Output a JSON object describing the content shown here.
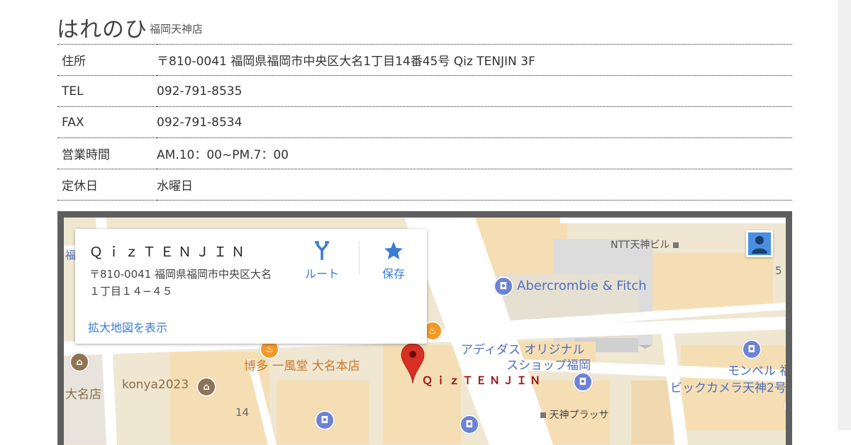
{
  "header": {
    "logo": "はれのひ",
    "branch": "福岡天神店"
  },
  "info_rows": [
    {
      "label": "住所",
      "value": "〒810-0041 福岡県福岡市中央区大名1丁目14番45号 Qiz TENJIN 3F"
    },
    {
      "label": "TEL",
      "value": "092-791-8535"
    },
    {
      "label": "FAX",
      "value": "092-791-8534"
    },
    {
      "label": "営業時間",
      "value": "AM.10：00~PM.7：00"
    },
    {
      "label": "定休日",
      "value": "水曜日"
    }
  ],
  "map": {
    "card": {
      "place_name": "ＱｉｚＴＥＮＪＩＮ",
      "address_line1": "〒810-0041 福岡県福岡市中央区大名",
      "address_line2": "１丁目１４−４５",
      "route_label": "ルート",
      "save_label": "保存",
      "enlarge_label": "拡大地図を表示"
    },
    "labels": {
      "ntt": "NTT天神ビル",
      "abercrombie": "Abercrombie & Fitch",
      "adidas_line1": "アディダス オリジナル",
      "adidas_line2": "スショップ福岡",
      "qiz": "ＱｉｚＴＥＮＪＩＮ",
      "ippudo": "博多 一風堂 大名本店",
      "konya": "konya2023",
      "daimyo": "大名店",
      "num14": "14",
      "montbell": "モンベル 福",
      "bic": "ビックカメラ天神2号",
      "tenjin_plaza": "天神プラッサ",
      "fuku": "福",
      "num5": "5"
    },
    "colors": {
      "road": "#ffffff",
      "block": "#efe7d2",
      "building": "#f5deb3",
      "poi_blue": "#6e82d4",
      "marker": "#d93025"
    }
  }
}
